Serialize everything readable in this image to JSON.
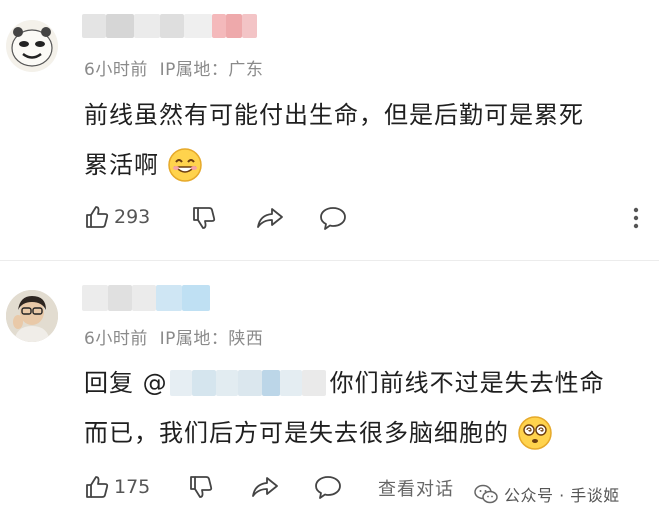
{
  "comments": [
    {
      "meta": "6小时前  IP属地：广东",
      "text_line1": "前线虽然有可能付出生命，但是后勤可是累死",
      "text_line2": "累活啊",
      "likes": "293"
    },
    {
      "meta": "6小时前  IP属地：陕西",
      "reply_prefix": "回复 @",
      "text_line1_rest": "你们前线不过是失去性命",
      "text_line2": "而已，我们后方可是失去很多脑细胞的",
      "likes": "175",
      "view_dialog": "查看对话"
    }
  ],
  "watermark": "公众号 · 手谈姬",
  "icons": [
    "like-icon",
    "dislike-icon",
    "share-icon",
    "comment-icon",
    "more-icon",
    "wechat-icon"
  ]
}
